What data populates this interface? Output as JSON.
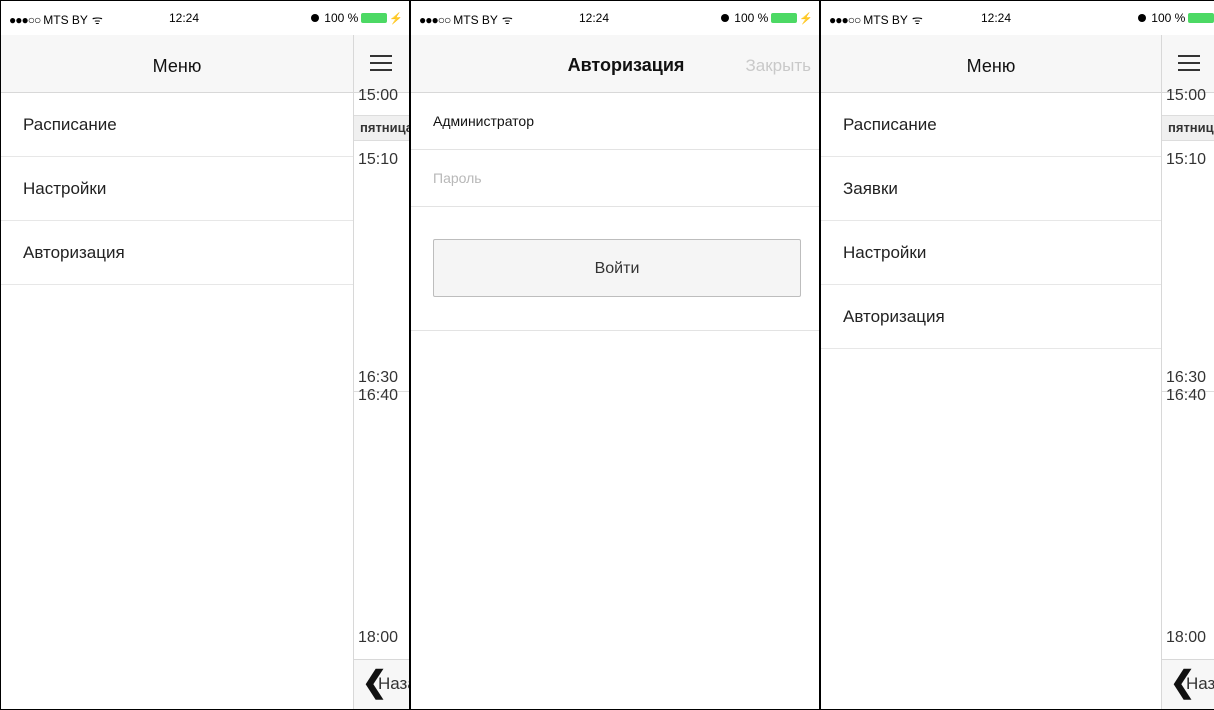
{
  "status": {
    "dots": "●●●○○",
    "carrier": "MTS BY",
    "wifi": "ᯤ",
    "time": "12:24",
    "battery": "100 %",
    "bolt": "⚡"
  },
  "screen1": {
    "menu_title": "Меню",
    "menu_items": [
      "Расписание",
      "Настройки",
      "Авторизация"
    ],
    "behind": {
      "times": [
        "15:00",
        "15:10",
        "16:30",
        "16:40",
        "18:00"
      ],
      "day": "пятница",
      "back": "Назад"
    }
  },
  "screen2": {
    "title": "Авторизация",
    "close": "Закрыть",
    "login_value": "Администратор",
    "password_placeholder": "Пароль",
    "login_button": "Войти"
  },
  "screen3": {
    "menu_title": "Меню",
    "menu_items": [
      "Расписание",
      "Заявки",
      "Настройки",
      "Авторизация"
    ],
    "behind": {
      "times": [
        "15:00",
        "15:10",
        "16:30",
        "16:40",
        "18:00"
      ],
      "day": "пятница",
      "back": "Назад"
    }
  },
  "colors": {
    "battery": "#4cd964",
    "header_bg": "#f7f7f7",
    "close_text": "#c9c9c9"
  }
}
